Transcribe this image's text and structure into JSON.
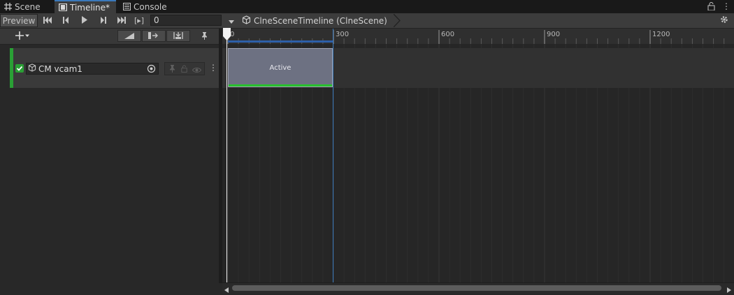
{
  "tabs": [
    {
      "label": "Scene",
      "icon": "grid-icon",
      "active": false
    },
    {
      "label": "Timeline*",
      "icon": "film-icon",
      "active": true
    },
    {
      "label": "Console",
      "icon": "console-icon",
      "active": false
    }
  ],
  "toolbar": {
    "preview_label": "Preview",
    "frame_toggle_label": "[▸]",
    "frame_value": "0",
    "breadcrumb": "ClneSceneTimeline (ClneScene)"
  },
  "ruler": {
    "ticks": [
      {
        "label": "0",
        "pos": 0
      },
      {
        "label": "300",
        "pos": 300
      },
      {
        "label": "600",
        "pos": 600
      },
      {
        "label": "900",
        "pos": 900
      },
      {
        "label": "1200",
        "pos": 1200
      }
    ]
  },
  "track": {
    "name": "CM vcam1",
    "enabled": true
  },
  "clip": {
    "label": "Active"
  },
  "colors": {
    "accent": "#3a79bb",
    "track_green": "#2aa035",
    "clip": "#6d7182"
  }
}
